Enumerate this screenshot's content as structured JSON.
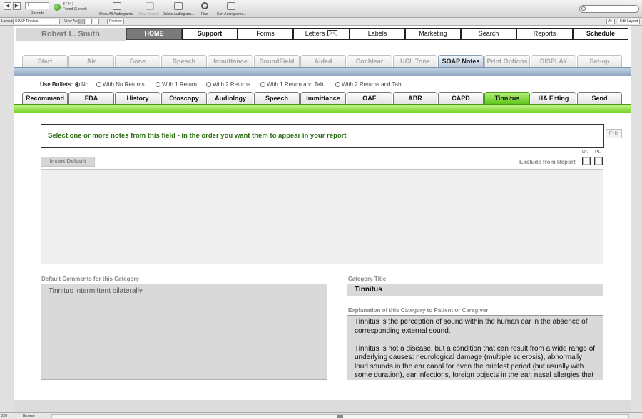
{
  "toolbar": {
    "records_value": "1",
    "records_label": "Records",
    "found_count": "3 / 447",
    "found_status": "Found (Sorted)",
    "show_all": "Show All Audiograms",
    "new_record": "New Record",
    "delete": "Delete Audiogram...",
    "find": "Find",
    "sort": "Sort Audiograms...",
    "search_value": "",
    "aa": "A↑",
    "edit_layout": "Edit Layout"
  },
  "layoutbar": {
    "layout_label": "Layout:",
    "layout_value": "SOAP Tinnitus",
    "view_label": "View As:",
    "preview": "Preview"
  },
  "header": {
    "patient_name": "Robert L. Smith",
    "nav": [
      {
        "label": "HOME"
      },
      {
        "label": "Support"
      },
      {
        "label": "Forms"
      },
      {
        "label": "Letters"
      },
      {
        "label": "Labels"
      },
      {
        "label": "Marketing"
      },
      {
        "label": "Search"
      },
      {
        "label": "Reports"
      },
      {
        "label": "Schedule"
      }
    ]
  },
  "modules": [
    {
      "label": "Start"
    },
    {
      "label": "Air"
    },
    {
      "label": "Bone"
    },
    {
      "label": "Speech"
    },
    {
      "label": "Immittance"
    },
    {
      "label": "SoundField"
    },
    {
      "label": "Aided"
    },
    {
      "label": "Cochlear"
    },
    {
      "label": "UCL Tone"
    },
    {
      "label": "SOAP Notes"
    },
    {
      "label": "Print Options"
    },
    {
      "label": "DISPLAY"
    },
    {
      "label": "Set-up"
    }
  ],
  "bullets": {
    "label": "Use Bullets:",
    "options": [
      {
        "label": "No"
      },
      {
        "label": "With No Returns"
      },
      {
        "label": "With 1 Return"
      },
      {
        "label": "With 2 Returns"
      },
      {
        "label": "With 1 Return and Tab"
      },
      {
        "label": "With 2 Returns and Tab"
      }
    ]
  },
  "categories": [
    {
      "label": "Recommend"
    },
    {
      "label": "FDA"
    },
    {
      "label": "History"
    },
    {
      "label": "Otoscopy"
    },
    {
      "label": "Audiology"
    },
    {
      "label": "Speech"
    },
    {
      "label": "Immittance"
    },
    {
      "label": "OAE"
    },
    {
      "label": "ABR"
    },
    {
      "label": "CAPD"
    },
    {
      "label": "Tinnitus"
    },
    {
      "label": "HA Fitting"
    },
    {
      "label": "Send"
    }
  ],
  "notes": {
    "instruction": "Select one or more notes from this field -  in the order you want them to appear in your report",
    "edit": "Edit",
    "insert_default": "Insert Default",
    "exclude": "Exclude from Report",
    "dr": "Dr.",
    "pt": "Pt."
  },
  "details": {
    "default_label": "Default Comments for this Category",
    "default_text": "Tinnitus intermittent bilaterally.",
    "title_label": "Category Title",
    "title_value": "Tinnitus",
    "explanation_label": "Explanation of this Category to Patient or Caregiver",
    "explanation_p1": "Tinnitus is the perception of sound within the human ear in the absence of corresponding external sound.",
    "explanation_p2": "Tinnitus is not a disease, but a condition that can result from a wide range of underlying causes: neurological damage (multiple sclerosis), abnormally loud sounds in the ear canal for even the briefest period (but usually with some duration), ear infections, foreign objects in the ear, nasal allergies that prevent"
  },
  "status": {
    "zoom": "200",
    "mode": "Browse"
  },
  "colors": {
    "active_category": "#5ec51c",
    "active_module": "#b9c9da",
    "home_tab": "#7a7a7a",
    "instruction_text": "#2d6e12"
  }
}
